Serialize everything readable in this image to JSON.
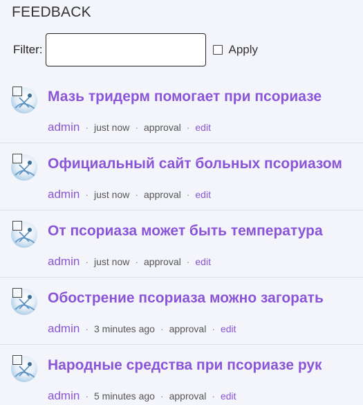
{
  "header": {
    "title": "FEEDBACK"
  },
  "filter": {
    "label": "Filter:",
    "value": "",
    "placeholder": "",
    "apply_label": "Apply"
  },
  "items": [
    {
      "title": "Мазь тридерм помогает при псориазе",
      "author": "admin",
      "time": "just now",
      "status": "approval",
      "edit": "edit"
    },
    {
      "title": "Официальный сайт больных псориазом",
      "author": "admin",
      "time": "just now",
      "status": "approval",
      "edit": "edit"
    },
    {
      "title": "От псориаза может быть температура",
      "author": "admin",
      "time": "just now",
      "status": "approval",
      "edit": "edit"
    },
    {
      "title": "Обострение псориаза можно загорать",
      "author": "admin",
      "time": "3 minutes ago",
      "status": "approval",
      "edit": "edit"
    },
    {
      "title": "Народные средства при псориазе рук",
      "author": "admin",
      "time": "5 minutes ago",
      "status": "approval",
      "edit": "edit"
    }
  ],
  "meta_separator": "·",
  "colors": {
    "accent": "#8a55d8",
    "background": "#f3f5fa"
  },
  "icons": {
    "avatar": "default-user-avatar-icon",
    "select": "checkbox-icon"
  }
}
